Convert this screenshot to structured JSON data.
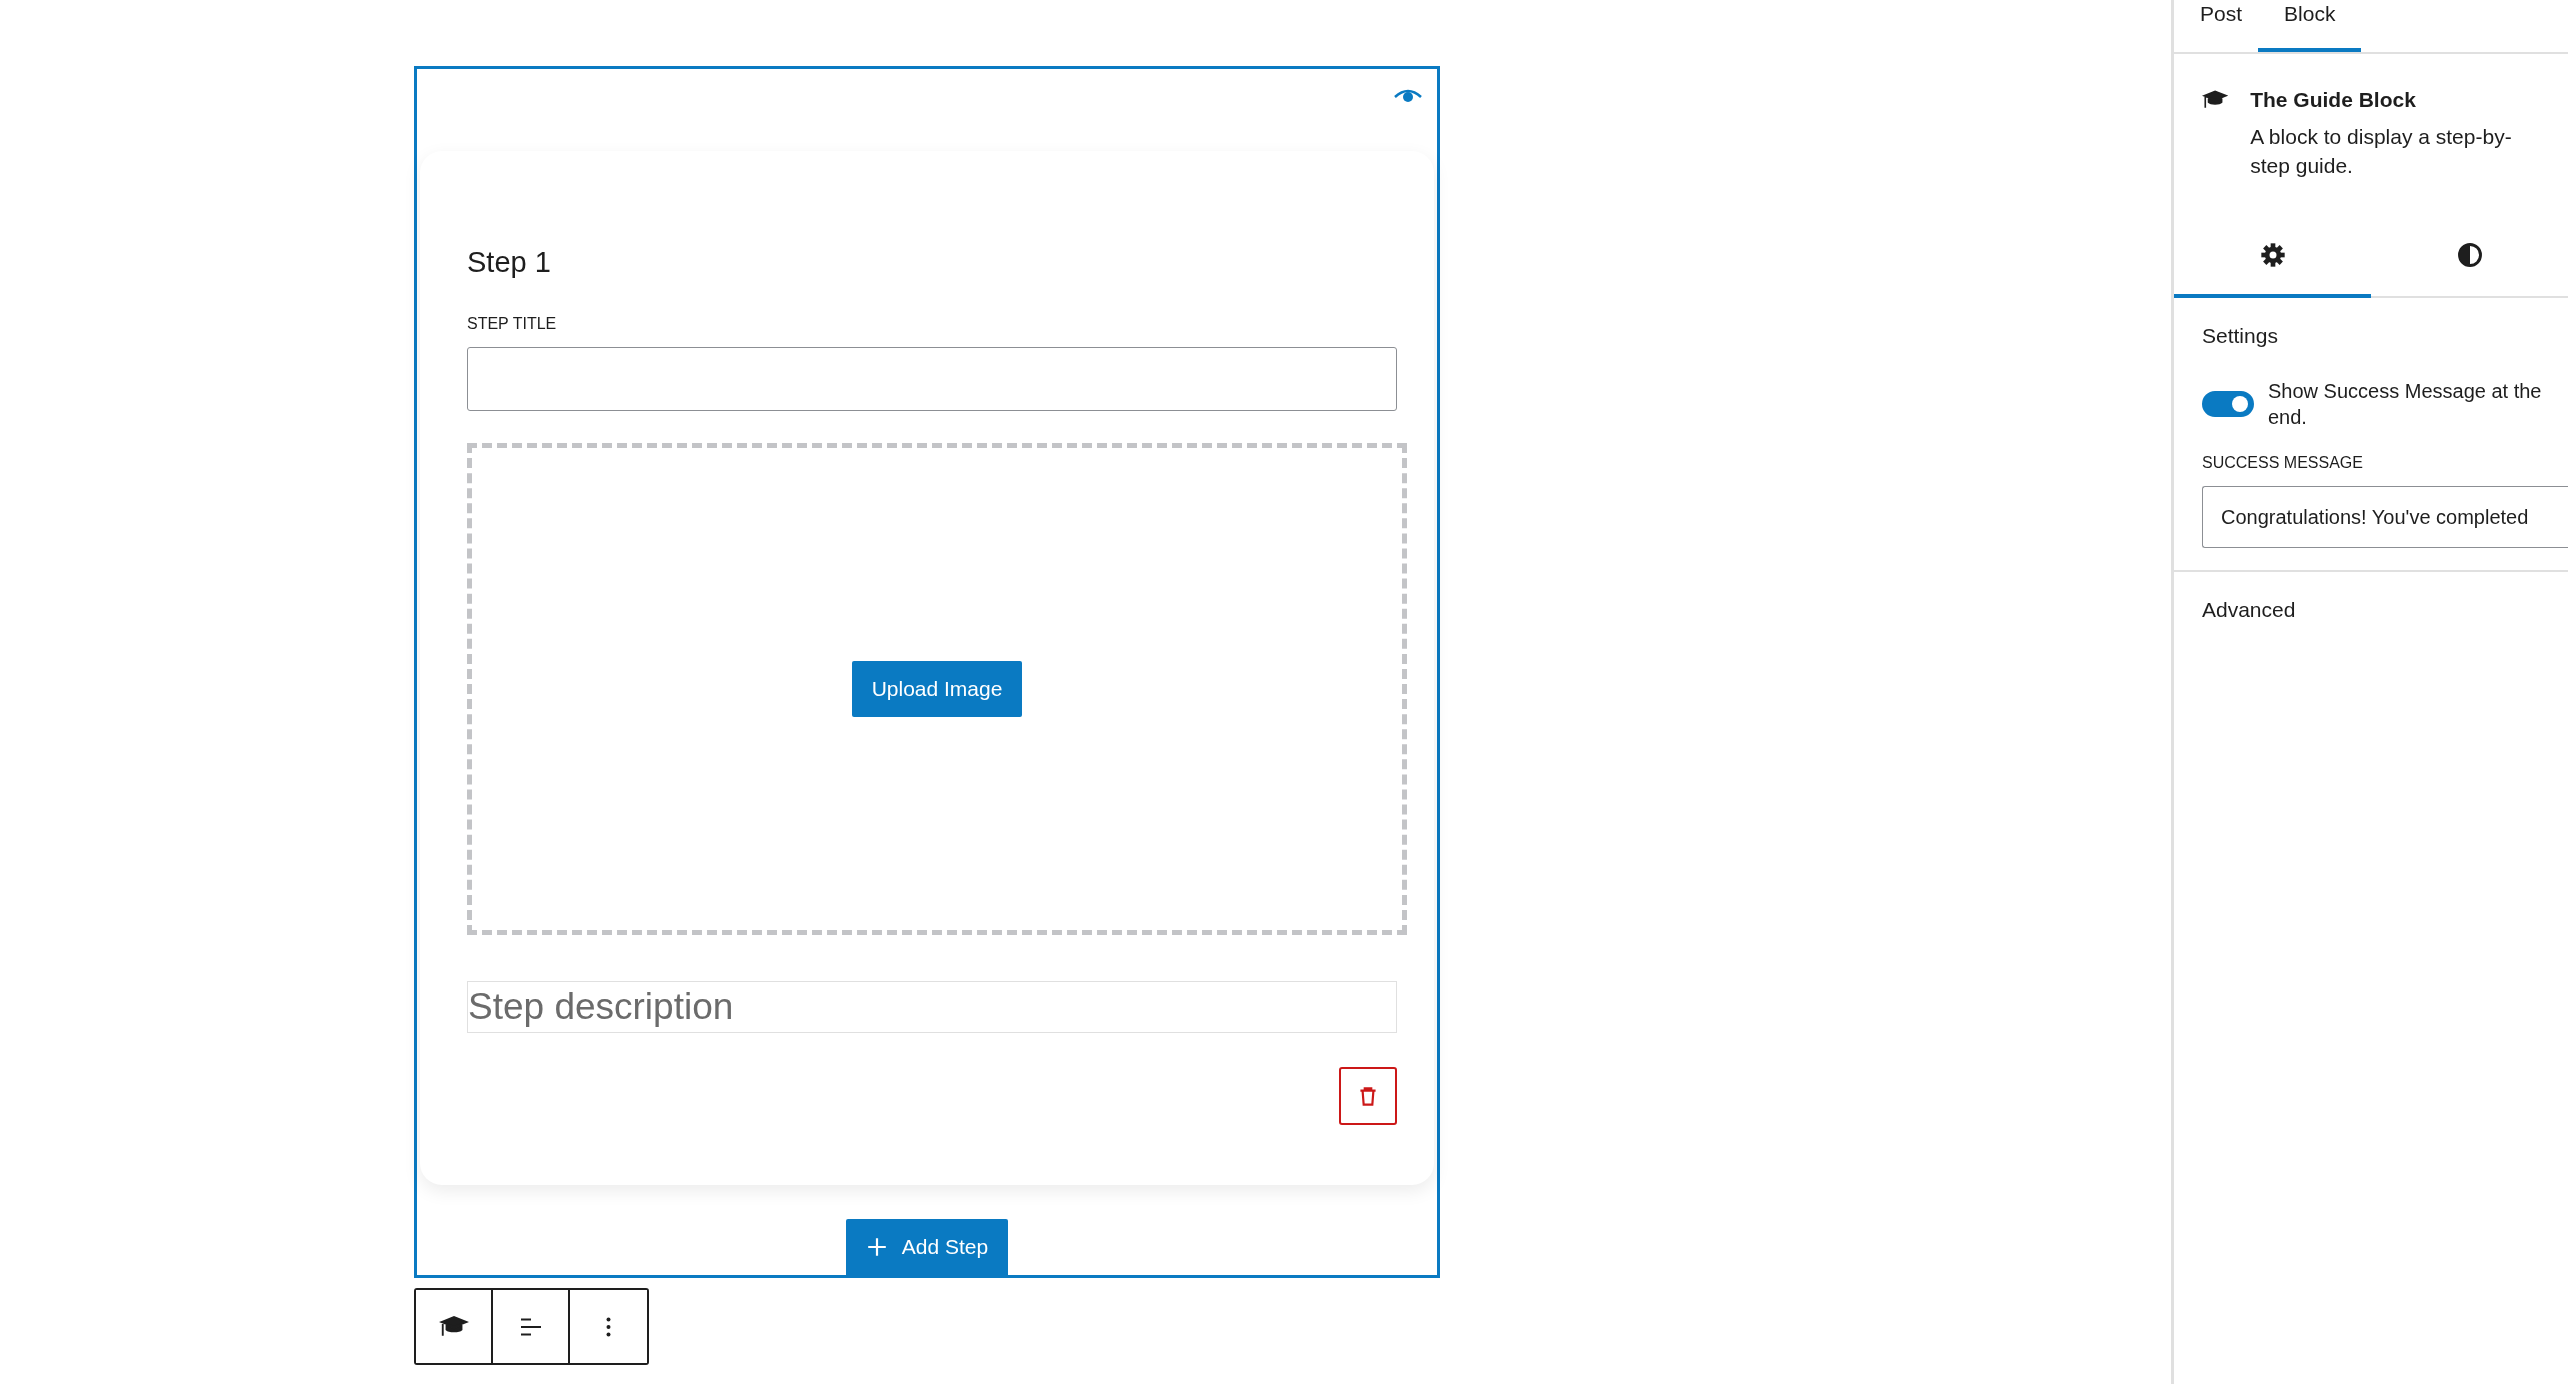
{
  "block": {
    "preview_visible": true,
    "step": {
      "heading": "Step 1",
      "title_label": "STEP TITLE",
      "upload_button": "Upload Image",
      "description_placeholder": "Step description"
    },
    "add_button": "Add Step"
  },
  "toolbar": [
    {
      "kind": "guide"
    },
    {
      "kind": "align"
    },
    {
      "kind": "more"
    }
  ],
  "sidebar": {
    "tabs": [
      {
        "label": "Post",
        "selected": false
      },
      {
        "label": "Block",
        "selected": true
      }
    ],
    "block_card": {
      "title": "The Guide Block",
      "description": "A block to display a step-by-step guide."
    },
    "icon_tabs": [
      {
        "kind": "settings",
        "selected": true
      },
      {
        "kind": "styles",
        "selected": false
      }
    ],
    "panels": [
      {
        "title": "Settings",
        "toggle": {
          "label": "Show Success Message at the end.",
          "on": true
        },
        "field_label": "SUCCESS MESSAGE",
        "field_value": "Congratulations! You've completed"
      },
      {
        "title": "Advanced"
      }
    ]
  }
}
